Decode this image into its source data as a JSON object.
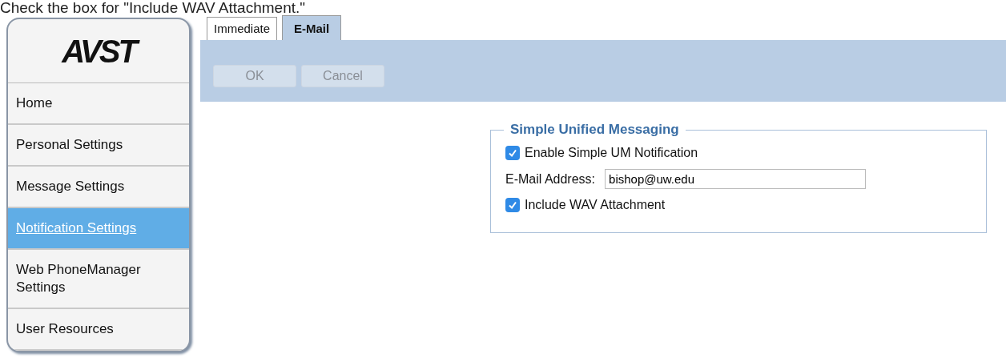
{
  "caption": "Check the box for \"Include WAV Attachment.\"",
  "sidebar": {
    "logo": "AVST",
    "items": [
      {
        "label": "Home",
        "selected": false
      },
      {
        "label": "Personal Settings",
        "selected": false
      },
      {
        "label": "Message Settings",
        "selected": false
      },
      {
        "label": "Notification Settings",
        "selected": true
      },
      {
        "label": "Web PhoneManager Settings",
        "selected": false
      },
      {
        "label": "User Resources",
        "selected": false
      }
    ]
  },
  "tabs": [
    {
      "label": "Immediate",
      "selected": false
    },
    {
      "label": "E-Mail",
      "selected": true
    }
  ],
  "buttons": [
    {
      "label": "OK",
      "disabled": true
    },
    {
      "label": "Cancel",
      "disabled": true
    }
  ],
  "fieldset": {
    "legend": "Simple Unified Messaging",
    "rows": [
      {
        "kind": "checkbox",
        "label": "Enable Simple UM Notification",
        "checked": true
      },
      {
        "kind": "text",
        "label": "E-Mail Address:",
        "value": "bishop@uw.edu"
      },
      {
        "kind": "checkbox",
        "label": "Include WAV Attachment",
        "checked": true
      }
    ]
  }
}
